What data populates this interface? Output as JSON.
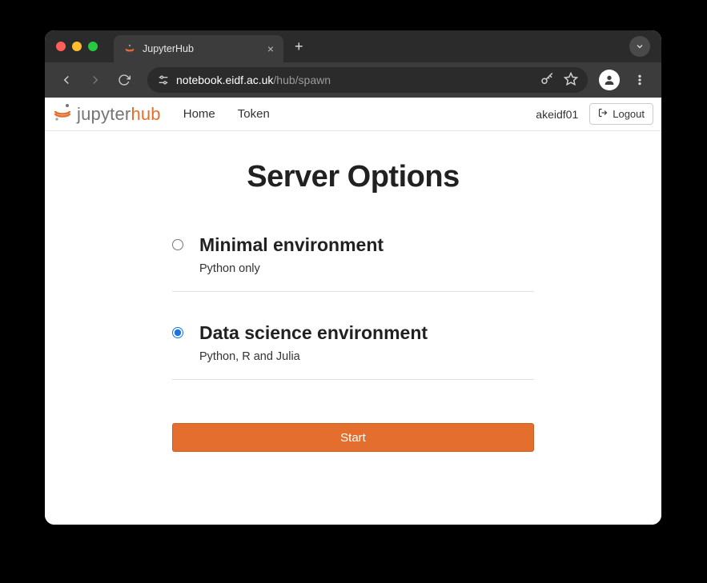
{
  "browser": {
    "tab_title": "JupyterHub",
    "url_domain": "notebook.eidf.ac.uk",
    "url_path": "/hub/spawn"
  },
  "navbar": {
    "logo_text_1": "jupyter",
    "logo_text_2": "hub",
    "links": {
      "home": "Home",
      "token": "Token"
    },
    "username": "akeidf01",
    "logout": "Logout"
  },
  "page": {
    "title": "Server Options",
    "options": [
      {
        "title": "Minimal environment",
        "desc": "Python only",
        "selected": false
      },
      {
        "title": "Data science environment",
        "desc": "Python, R and Julia",
        "selected": true
      }
    ],
    "start_button": "Start"
  }
}
